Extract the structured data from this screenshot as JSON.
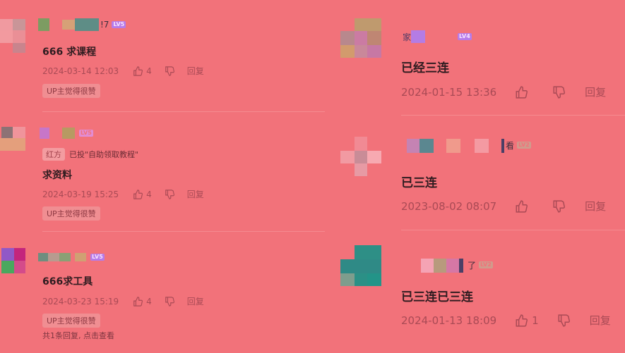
{
  "left": [
    {
      "name_suffix": "!7",
      "level": "LV5",
      "content": "666 求课程",
      "time": "2024-03-14 12:03",
      "likes": "4",
      "reply_label": "回复",
      "badge": "UP主觉得很赞"
    },
    {
      "name_suffix": "",
      "level": "LV5",
      "tag": "红方",
      "tag_text": "已投\"自助领取教程\"",
      "content": "求资料",
      "time": "2024-03-19 15:25",
      "likes": "4",
      "reply_label": "回复",
      "badge": "UP主觉得很赞"
    },
    {
      "name_suffix": "",
      "level": "LV5",
      "content": "666求工具",
      "time": "2024-03-23 15:19",
      "likes": "4",
      "reply_label": "回复",
      "badge": "UP主觉得很赞",
      "more_replies": "共1条回复, 点击查看"
    }
  ],
  "right": [
    {
      "name_prefix": "家",
      "level": "LV4",
      "content": "已经三连",
      "time": "2024-01-15 13:36",
      "likes": "",
      "reply_label": "回复"
    },
    {
      "name_suffix": "看",
      "level": "LV2",
      "content": "已三连",
      "time": "2023-08-02 08:07",
      "likes": "",
      "reply_label": "回复"
    },
    {
      "name_suffix": "了",
      "level": "LV2",
      "content": "已三连已三连",
      "time": "2024-01-13 18:09",
      "likes": "1",
      "reply_label": "回复"
    }
  ],
  "colors": {
    "background": "#f2727a",
    "level_badge": "#b67be9",
    "meta_text": "#a94a55"
  }
}
